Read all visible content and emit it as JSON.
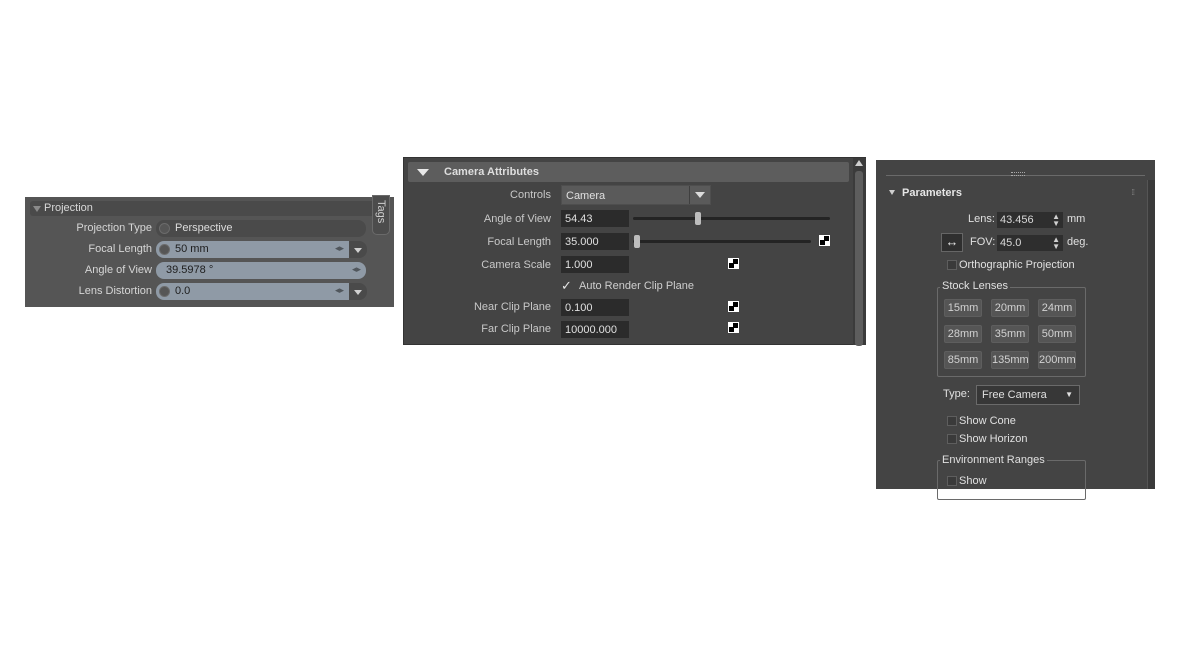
{
  "projection_panel": {
    "title": "Projection",
    "tags_tab": "Tags",
    "rows": [
      {
        "label": "Projection Type",
        "value": "Perspective"
      },
      {
        "label": "Focal Length",
        "value": "50 mm"
      },
      {
        "label": "Angle of View",
        "value": "39.5978 °"
      },
      {
        "label": "Lens Distortion",
        "value": "0.0"
      }
    ]
  },
  "camera_attributes_panel": {
    "title": "Camera Attributes",
    "controls_label": "Controls",
    "controls_value": "Camera",
    "angle_of_view_label": "Angle of View",
    "angle_of_view_value": "54.43",
    "focal_length_label": "Focal Length",
    "focal_length_value": "35.000",
    "camera_scale_label": "Camera Scale",
    "camera_scale_value": "1.000",
    "auto_render_label": "Auto Render Clip Plane",
    "auto_render_checked": true,
    "near_clip_label": "Near Clip Plane",
    "near_clip_value": "0.100",
    "far_clip_label": "Far Clip Plane",
    "far_clip_value": "10000.000"
  },
  "parameters_panel": {
    "title": "Parameters",
    "lens_label": "Lens:",
    "lens_value": "43.456",
    "lens_unit": "mm",
    "fov_label": "FOV:",
    "fov_value": "45.0",
    "fov_unit": "deg.",
    "fov_toggle_glyph": "↔",
    "ortho_label": "Orthographic Projection",
    "stock_lenses_title": "Stock Lenses",
    "stock_lenses": [
      "15mm",
      "20mm",
      "24mm",
      "28mm",
      "35mm",
      "50mm",
      "85mm",
      "135mm",
      "200mm"
    ],
    "type_label": "Type:",
    "type_value": "Free Camera",
    "show_cone_label": "Show Cone",
    "show_horizon_label": "Show Horizon",
    "env_ranges_title": "Environment Ranges",
    "env_show_label": "Show"
  }
}
